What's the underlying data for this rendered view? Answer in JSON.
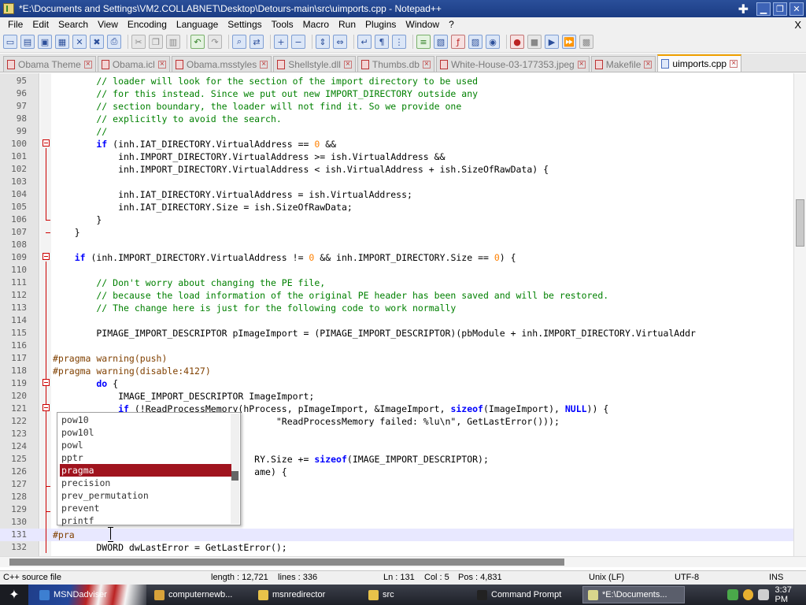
{
  "window": {
    "title": "*E:\\Documents and Settings\\VM2.COLLABNET\\Desktop\\Detours-main\\src\\uimports.cpp - Notepad++"
  },
  "menu": [
    "File",
    "Edit",
    "Search",
    "View",
    "Encoding",
    "Language",
    "Settings",
    "Tools",
    "Macro",
    "Run",
    "Plugins",
    "Window",
    "?"
  ],
  "menu_close": "X",
  "toolbar": {
    "icons": [
      "new-file-icon",
      "open-file-icon",
      "save-icon",
      "save-all-icon",
      "close-icon",
      "close-all-icon",
      "print-icon",
      "sep",
      "cut-icon",
      "copy-icon",
      "paste-icon",
      "sep",
      "undo-icon",
      "redo-icon",
      "sep",
      "find-icon",
      "replace-icon",
      "sep",
      "zoom-in-icon",
      "zoom-out-icon",
      "sep",
      "sync-v-icon",
      "sync-h-icon",
      "sep",
      "wrap-icon",
      "show-all-icon",
      "indent-guide-icon",
      "sep",
      "udl-icon",
      "doc-map-icon",
      "function-list-icon",
      "folder-workspace-icon",
      "monitor-icon",
      "sep",
      "record-macro-icon",
      "stop-record-icon",
      "play-macro-icon",
      "run-macro-icon",
      "save-macro-icon"
    ]
  },
  "tabs": [
    {
      "label": "Obama Theme",
      "active": false
    },
    {
      "label": "Obama.icl",
      "active": false
    },
    {
      "label": "Obama.msstyles",
      "active": false
    },
    {
      "label": "Shellstyle.dll",
      "active": false
    },
    {
      "label": "Thumbs.db",
      "active": false
    },
    {
      "label": "White-House-03-177353.jpeg",
      "active": false
    },
    {
      "label": "Makefile",
      "active": false
    },
    {
      "label": "uimports.cpp",
      "active": true
    }
  ],
  "editor": {
    "lines": [
      {
        "n": "95",
        "t": [
          {
            "c": "cm",
            "s": "        // loader will look for the section of the import directory to be used"
          }
        ]
      },
      {
        "n": "96",
        "t": [
          {
            "c": "cm",
            "s": "        // for this instead. Since we put out new IMPORT_DIRECTORY outside any"
          }
        ]
      },
      {
        "n": "97",
        "t": [
          {
            "c": "cm",
            "s": "        // section boundary, the loader will not find it. So we provide one"
          }
        ]
      },
      {
        "n": "98",
        "t": [
          {
            "c": "cm",
            "s": "        // explicitly to avoid the search."
          }
        ]
      },
      {
        "n": "99",
        "t": [
          {
            "c": "cm",
            "s": "        //"
          }
        ]
      },
      {
        "n": "100",
        "t": [
          {
            "c": "kw",
            "s": "        if"
          },
          {
            "c": "",
            "s": " (inh.IAT_DIRECTORY.VirtualAddress == "
          },
          {
            "c": "num",
            "s": "0"
          },
          {
            "c": "",
            "s": " &&"
          }
        ]
      },
      {
        "n": "101",
        "t": [
          {
            "c": "",
            "s": "            inh.IMPORT_DIRECTORY.VirtualAddress >= ish.VirtualAddress &&"
          }
        ]
      },
      {
        "n": "102",
        "t": [
          {
            "c": "",
            "s": "            inh.IMPORT_DIRECTORY.VirtualAddress < ish.VirtualAddress + ish.SizeOfRawData) {"
          }
        ]
      },
      {
        "n": "103",
        "t": [
          {
            "c": "",
            "s": ""
          }
        ]
      },
      {
        "n": "104",
        "t": [
          {
            "c": "",
            "s": "            inh.IAT_DIRECTORY.VirtualAddress = ish.VirtualAddress;"
          }
        ]
      },
      {
        "n": "105",
        "t": [
          {
            "c": "",
            "s": "            inh.IAT_DIRECTORY.Size = ish.SizeOfRawData;"
          }
        ]
      },
      {
        "n": "106",
        "t": [
          {
            "c": "",
            "s": "        }"
          }
        ]
      },
      {
        "n": "107",
        "t": [
          {
            "c": "",
            "s": "    }"
          }
        ]
      },
      {
        "n": "108",
        "t": [
          {
            "c": "",
            "s": ""
          }
        ]
      },
      {
        "n": "109",
        "t": [
          {
            "c": "kw",
            "s": "    if"
          },
          {
            "c": "",
            "s": " (inh.IMPORT_DIRECTORY.VirtualAddress != "
          },
          {
            "c": "num",
            "s": "0"
          },
          {
            "c": "",
            "s": " && inh.IMPORT_DIRECTORY.Size == "
          },
          {
            "c": "num",
            "s": "0"
          },
          {
            "c": "",
            "s": ") {"
          }
        ]
      },
      {
        "n": "110",
        "t": [
          {
            "c": "",
            "s": ""
          }
        ]
      },
      {
        "n": "111",
        "t": [
          {
            "c": "cm",
            "s": "        // Don't worry about changing the PE file,"
          }
        ]
      },
      {
        "n": "112",
        "t": [
          {
            "c": "cm",
            "s": "        // because the load information of the original PE header has been saved and will be restored."
          }
        ]
      },
      {
        "n": "113",
        "t": [
          {
            "c": "cm",
            "s": "        // The change here is just for the following code to work normally"
          }
        ]
      },
      {
        "n": "114",
        "t": [
          {
            "c": "",
            "s": ""
          }
        ]
      },
      {
        "n": "115",
        "t": [
          {
            "c": "",
            "s": "        PIMAGE_IMPORT_DESCRIPTOR pImageImport = (PIMAGE_IMPORT_DESCRIPTOR)(pbModule + inh.IMPORT_DIRECTORY.VirtualAddr"
          }
        ]
      },
      {
        "n": "116",
        "t": [
          {
            "c": "",
            "s": ""
          }
        ]
      },
      {
        "n": "117",
        "t": [
          {
            "c": "pp",
            "s": "#pragma warning(push)"
          }
        ]
      },
      {
        "n": "118",
        "t": [
          {
            "c": "pp",
            "s": "#pragma warning(disable:4127)"
          }
        ]
      },
      {
        "n": "119",
        "t": [
          {
            "c": "kw",
            "s": "        do"
          },
          {
            "c": "",
            "s": " {"
          }
        ]
      },
      {
        "n": "120",
        "t": [
          {
            "c": "",
            "s": "            IMAGE_IMPORT_DESCRIPTOR ImageImport;"
          }
        ]
      },
      {
        "n": "121",
        "t": [
          {
            "c": "kw",
            "s": "            if"
          },
          {
            "c": "",
            "s": " (!ReadProcessMemory(hProcess, pImageImport, &ImageImport, "
          },
          {
            "c": "kw",
            "s": "sizeof"
          },
          {
            "c": "",
            "s": "(ImageImport), "
          },
          {
            "c": "kw",
            "s": "NULL"
          },
          {
            "c": "",
            "s": ")) {"
          }
        ]
      },
      {
        "n": "122",
        "t": [
          {
            "c": "",
            "s": "                                         \"ReadProcessMemory failed: %lu\\n\", GetLastError()));"
          }
        ]
      },
      {
        "n": "123",
        "t": [
          {
            "c": "",
            "s": ""
          }
        ]
      },
      {
        "n": "124",
        "t": [
          {
            "c": "",
            "s": ""
          }
        ]
      },
      {
        "n": "125",
        "t": [
          {
            "c": "",
            "s": "                                     RY.Size += "
          },
          {
            "c": "kw",
            "s": "sizeof"
          },
          {
            "c": "",
            "s": "(IMAGE_IMPORT_DESCRIPTOR);"
          }
        ]
      },
      {
        "n": "126",
        "t": [
          {
            "c": "",
            "s": "                                     ame) {"
          }
        ]
      },
      {
        "n": "127",
        "t": [
          {
            "c": "",
            "s": ""
          }
        ]
      },
      {
        "n": "128",
        "t": [
          {
            "c": "",
            "s": ""
          }
        ]
      },
      {
        "n": "129",
        "t": [
          {
            "c": "",
            "s": ""
          }
        ]
      },
      {
        "n": "130",
        "t": [
          {
            "c": "",
            "s": ""
          }
        ]
      },
      {
        "n": "131",
        "t": [
          {
            "c": "pp",
            "s": "#pra"
          }
        ],
        "current": true
      },
      {
        "n": "132",
        "t": [
          {
            "c": "",
            "s": "        DWORD dwLastError = GetLastError();"
          }
        ]
      }
    ]
  },
  "autocomplete": {
    "items": [
      "pow10",
      "pow10l",
      "powl",
      "pptr",
      "pragma",
      "precision",
      "prev_permutation",
      "prevent",
      "printf"
    ],
    "selected": 4
  },
  "status": {
    "language": "C++ source file",
    "length": "length : 12,721",
    "lines": "lines : 336",
    "ln": "Ln : 131",
    "col": "Col : 5",
    "pos": "Pos : 4,831",
    "eol": "Unix (LF)",
    "encoding": "UTF-8",
    "mode": "INS"
  },
  "taskbar": {
    "tasks": [
      {
        "label": "MSNDadviser",
        "icon": "ie-icon",
        "color": "#3d7fd1"
      },
      {
        "label": "computernewb...",
        "icon": "browser-icon",
        "color": "#d8a23a"
      },
      {
        "label": "msnredirector",
        "icon": "folder-icon",
        "color": "#e8c24a"
      },
      {
        "label": "src",
        "icon": "folder-icon",
        "color": "#e8c24a"
      },
      {
        "label": "Command Prompt",
        "icon": "cmd-icon",
        "color": "#222222"
      },
      {
        "label": "*E:\\Documents...",
        "icon": "notepad-icon",
        "color": "#d9d68c"
      }
    ],
    "clock": "3:37 PM"
  }
}
